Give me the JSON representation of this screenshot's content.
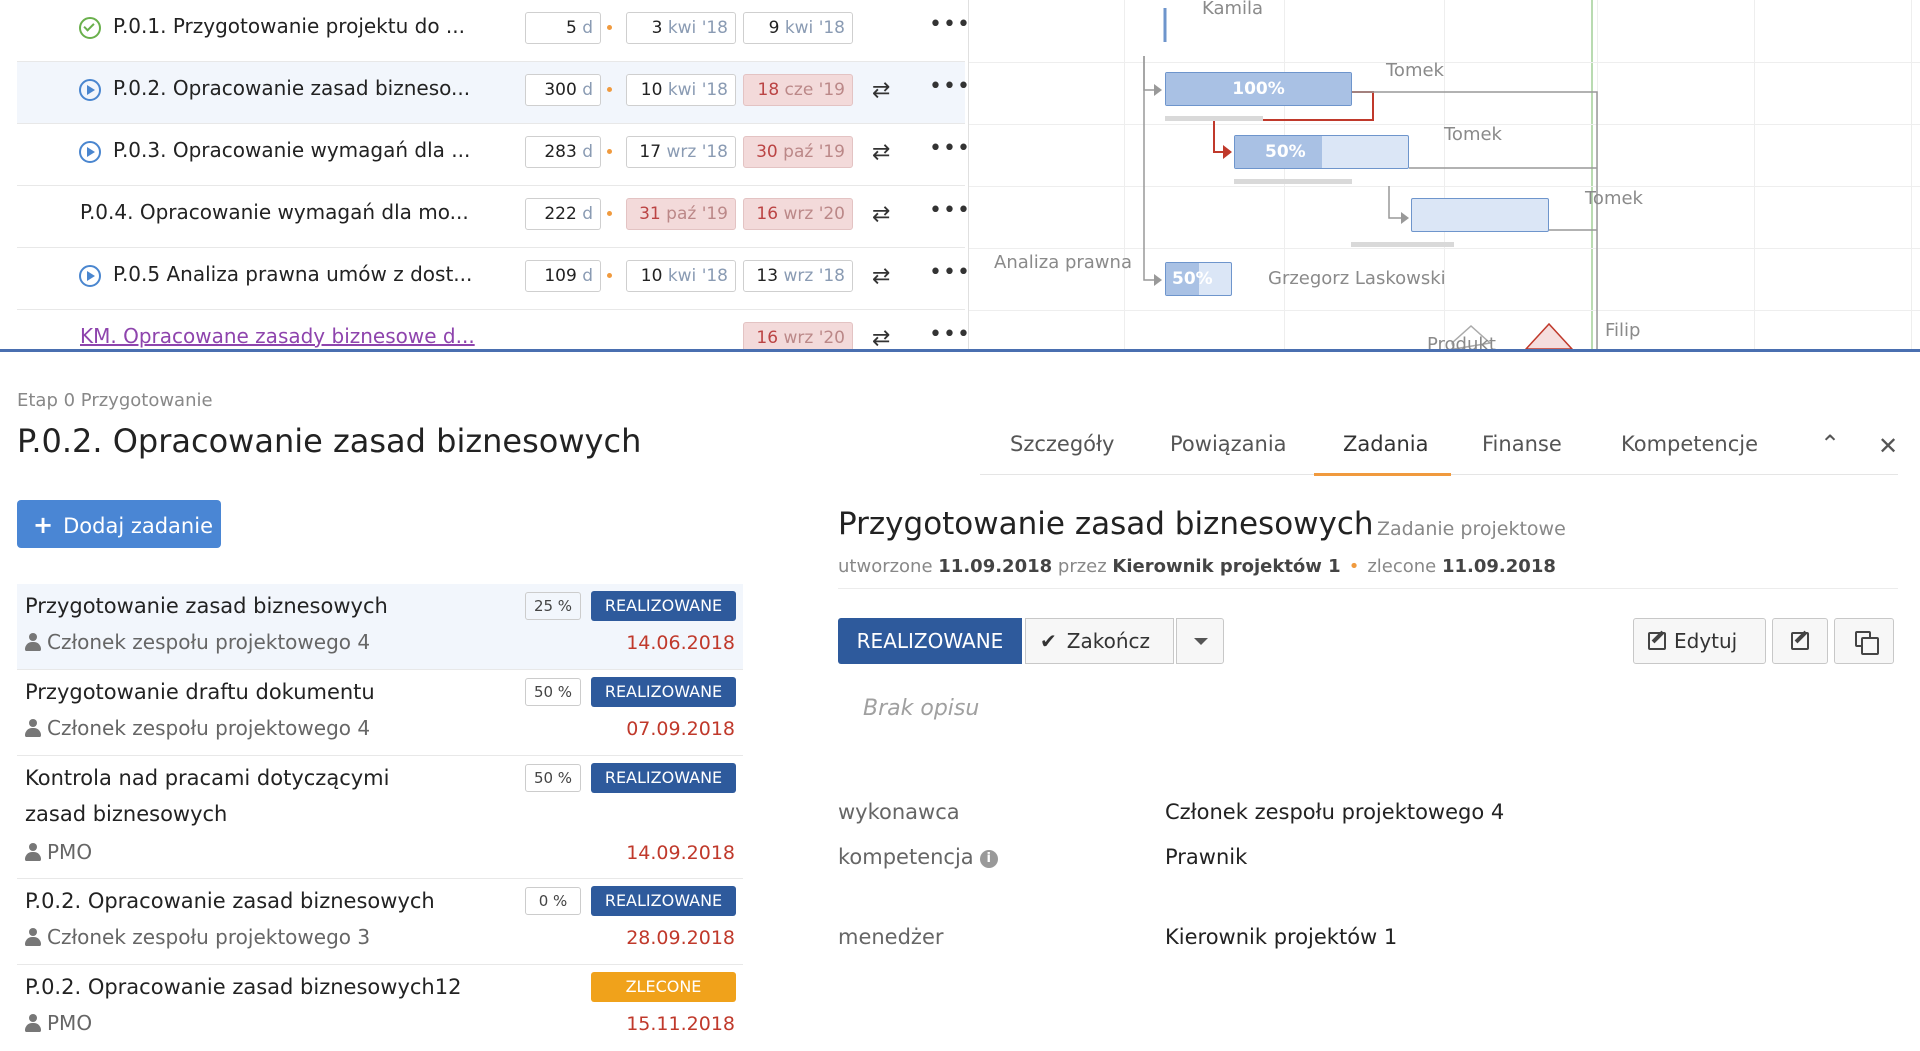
{
  "gantt_rows": [
    {
      "status": "done",
      "name": "P.0.1. Przygotowanie projektu do ...",
      "duration": "5",
      "unit": "d",
      "start_day": "3",
      "start_mon": "kwi '18",
      "end_day": "9",
      "end_mon": "kwi '18",
      "start_late": false,
      "end_late": false,
      "repeat": false
    },
    {
      "status": "play",
      "name": "P.0.2. Opracowanie zasad bizneso...",
      "duration": "300",
      "unit": "d",
      "start_day": "10",
      "start_mon": "kwi '18",
      "end_day": "18",
      "end_mon": "cze '19",
      "start_late": false,
      "end_late": true,
      "repeat": true
    },
    {
      "status": "play",
      "name": "P.0.3. Opracowanie wymagań dla ...",
      "duration": "283",
      "unit": "d",
      "start_day": "17",
      "start_mon": "wrz '18",
      "end_day": "30",
      "end_mon": "paź '19",
      "start_late": false,
      "end_late": true,
      "repeat": true
    },
    {
      "status": "none",
      "name": "P.0.4. Opracowanie wymagań dla mo...",
      "duration": "222",
      "unit": "d",
      "start_day": "31",
      "start_mon": "paź '19",
      "end_day": "16",
      "end_mon": "wrz '20",
      "start_late": true,
      "end_late": true,
      "repeat": true
    },
    {
      "status": "play",
      "name": "P.0.5 Analiza prawna umów z dost...",
      "duration": "109",
      "unit": "d",
      "start_day": "10",
      "start_mon": "kwi '18",
      "end_day": "13",
      "end_mon": "wrz '18",
      "start_late": false,
      "end_late": false,
      "repeat": true
    },
    {
      "status": "km",
      "name": "KM. Opracowane zasady biznesowe d...",
      "end_day": "16",
      "end_mon": "wrz '20"
    }
  ],
  "gantt_chart": {
    "labels": {
      "kamila": "Kamila",
      "tomek1": "Tomek",
      "tomek2": "Tomek",
      "tomek3": "Tomek",
      "analiza": "Analiza prawna",
      "grzegorz": "Grzegorz Laskowski",
      "produkt": "Produkt",
      "filip": "Filip"
    },
    "bar1": "100%",
    "bar2": "50%",
    "bar4": "50%",
    "bar_progress": {
      "bar1": 1.0,
      "bar2": 0.5,
      "bar3": 0,
      "bar4": 0.5
    }
  },
  "detail": {
    "breadcrumb": "Etap 0 Przygotowanie",
    "title": "P.0.2. Opracowanie zasad biznesowych",
    "tabs": [
      "Szczegóły",
      "Powiązania",
      "Zadania",
      "Finanse",
      "Kompetencje"
    ],
    "active_tab": "Zadania",
    "add_button": "Dodaj zadanie"
  },
  "tasks": [
    {
      "name": "Przygotowanie zasad biznesowych",
      "pct": "25 %",
      "status": "REALIZOWANE",
      "person": "Członek zespołu projektowego 4",
      "date": "14.06.2018"
    },
    {
      "name": "Przygotowanie draftu dokumentu",
      "pct": "50 %",
      "status": "REALIZOWANE",
      "person": "Członek zespołu projektowego 4",
      "date": "07.09.2018"
    },
    {
      "name": "Kontrola nad pracami dotyczącymi zasad biznesowych",
      "pct": "50 %",
      "status": "REALIZOWANE",
      "person": "PMO",
      "date": "14.09.2018"
    },
    {
      "name": "P.0.2. Opracowanie zasad biznesowych",
      "pct": "0 %",
      "status": "REALIZOWANE",
      "person": "Członek zespołu projektowego 3",
      "date": "28.09.2018"
    },
    {
      "name": "P.0.2. Opracowanie zasad biznesowych12",
      "pct": "",
      "status": "ZLECONE",
      "person": "PMO",
      "date": "15.11.2018"
    }
  ],
  "panel": {
    "title": "Przygotowanie zasad biznesowych",
    "type": "Zadanie projektowe",
    "created_label": "utworzone",
    "created_date": "11.09.2018",
    "by_label": "przez",
    "by": "Kierownik projektów 1",
    "assigned_label": "zlecone",
    "assigned_date": "11.09.2018",
    "status_button": "REALIZOWANE",
    "finish_button": "Zakończ",
    "edit_button": "Edytuj",
    "description": "Brak opisu",
    "fields": [
      {
        "label": "wykonawca",
        "value": "Członek zespołu projektowego 4"
      },
      {
        "label": "kompetencja",
        "value": "Prawnik"
      },
      {
        "label": "menedżer",
        "value": "Kierownik projektów 1"
      }
    ]
  },
  "colors": {
    "accent": "#4a86d4",
    "status_blue": "#2e5a9c",
    "orange": "#f0a21b",
    "late_red": "#c0392b"
  }
}
